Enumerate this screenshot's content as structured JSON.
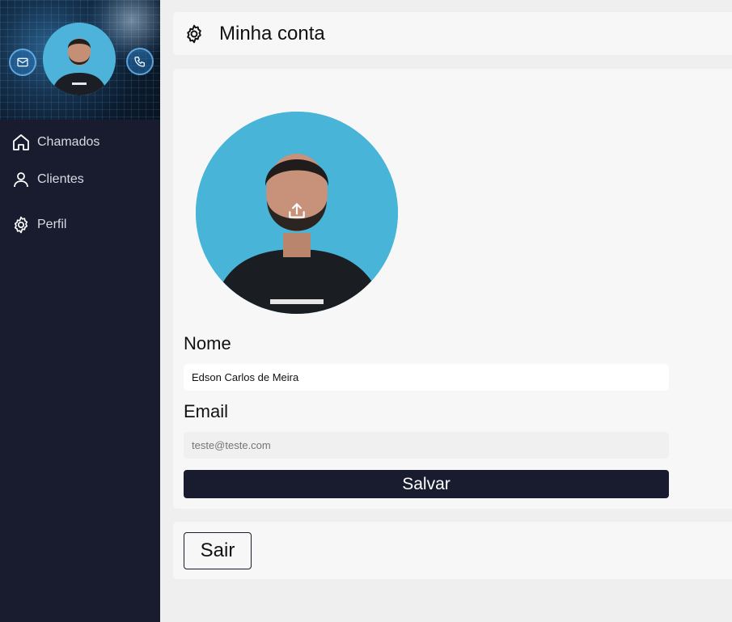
{
  "sidebar": {
    "banner_icons": [
      "envelope-icon",
      "phone-icon"
    ],
    "items": [
      {
        "label": "Chamados",
        "icon": "home-icon"
      },
      {
        "label": "Clientes",
        "icon": "user-icon"
      },
      {
        "label": "Perfil",
        "icon": "gear-icon"
      }
    ]
  },
  "header": {
    "icon": "gear-icon",
    "title": "Minha conta"
  },
  "profile_form": {
    "avatar_action_icon": "upload-icon",
    "name_label": "Nome",
    "name_value": "Edson Carlos de Meira",
    "email_label": "Email",
    "email_placeholder": "teste@teste.com",
    "save_label": "Salvar"
  },
  "logout": {
    "label": "Sair"
  },
  "colors": {
    "sidebar_bg": "#181c2e",
    "page_bg": "#efefef",
    "card_bg": "#f7f7f7",
    "primary_button": "#181c2e",
    "avatar_bg": "#48b4d8"
  }
}
